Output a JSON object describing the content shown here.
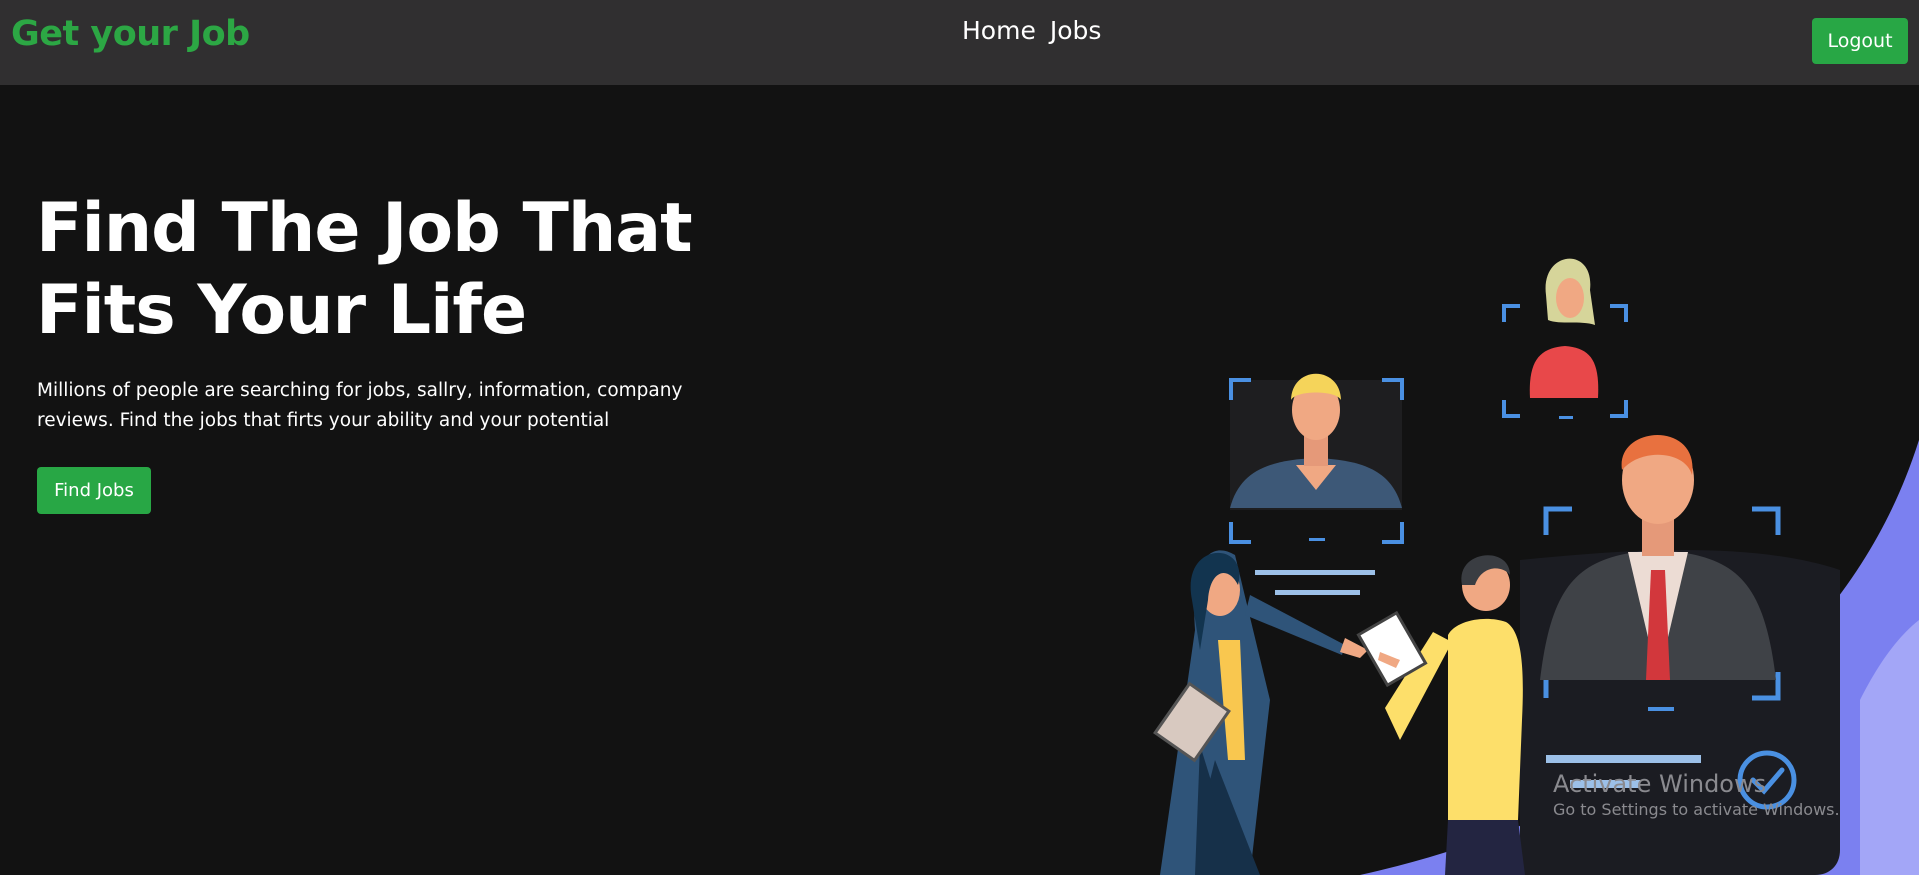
{
  "brand": {
    "name": "Get your Job"
  },
  "nav": {
    "items": [
      {
        "label": "Home"
      },
      {
        "label": "Jobs"
      }
    ],
    "logout_label": "Logout"
  },
  "hero": {
    "title_lines": [
      "Find The Job That",
      "Fits Your Life"
    ],
    "description_lines": [
      "Millions of people are searching for jobs, sallry, information, company",
      "reviews. Find the jobs that firts your ability and your potential"
    ],
    "cta_label": "Find Jobs"
  },
  "watermark": {
    "title": "Activate Windows",
    "subtitle": "Go to Settings to activate Windows."
  },
  "colors": {
    "accent": "#28a745",
    "brand_text": "#2ca744",
    "navbar_bg": "#302f30",
    "page_bg": "#121212",
    "illustration_blue": "#4a90e2",
    "illustration_purple": "#7b80f0"
  }
}
